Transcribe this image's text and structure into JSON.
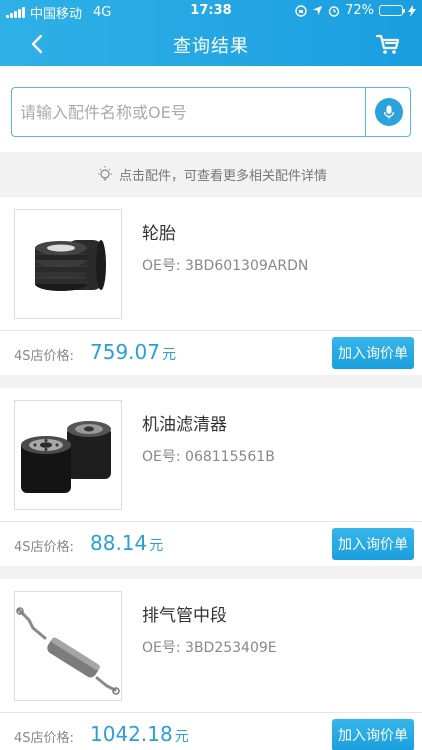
{
  "status_bar": {
    "carrier": "中国移动",
    "network": "4G",
    "time": "17:38",
    "battery": "72%",
    "battery_level": 0.72
  },
  "nav": {
    "title": "查询结果",
    "back_icon": "chevron-left-icon",
    "cart_icon": "cart-icon"
  },
  "search": {
    "placeholder": "请输入配件名称或OE号",
    "value": "",
    "voice_icon": "microphone-icon"
  },
  "tip": {
    "text": "点击配件，可查看更多相关配件详情",
    "icon": "lightbulb-icon"
  },
  "products": [
    {
      "name": "轮胎",
      "oe": "OE号: 3BD601309ARDN",
      "price_label": "4S店价格:",
      "price": "759.07",
      "unit": "元",
      "button": "加入询价单",
      "image": "tire-image"
    },
    {
      "name": "机油滤清器",
      "oe": "OE号: 068115561B",
      "price_label": "4S店价格:",
      "price": "88.14",
      "unit": "元",
      "button": "加入询价单",
      "image": "oil-filter-image"
    },
    {
      "name": "排气管中段",
      "oe": "OE号: 3BD253409E",
      "price_label": "4S店价格:",
      "price": "1042.18",
      "unit": "元",
      "button": "加入询价单",
      "image": "exhaust-pipe-image"
    }
  ],
  "colors": {
    "header": "#1a9ee0",
    "accent": "#2a9fd8",
    "button": "#1a9edd"
  }
}
